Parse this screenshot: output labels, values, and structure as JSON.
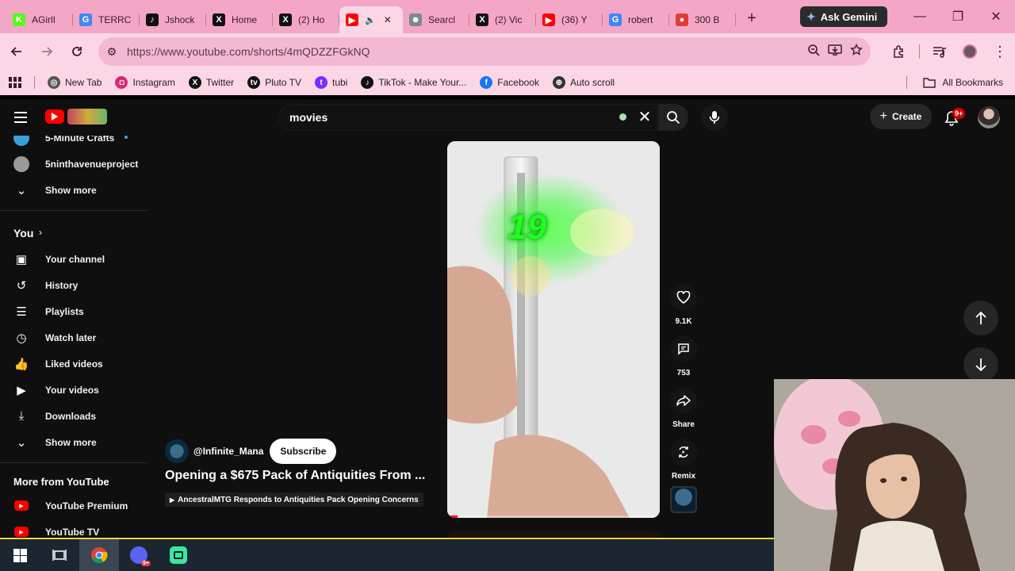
{
  "browser": {
    "tabs": [
      {
        "title": "AGirlI",
        "icon": "kick-icon",
        "color": "#53fc18",
        "glyph": "K"
      },
      {
        "title": "TERRC",
        "icon": "google-icon",
        "color": "#4285f4",
        "glyph": "G"
      },
      {
        "title": "Jshock",
        "icon": "tiktok-icon",
        "color": "#111111",
        "glyph": "♪"
      },
      {
        "title": "Home",
        "icon": "x-icon",
        "color": "#111111",
        "glyph": "X"
      },
      {
        "title": "(2) Ho",
        "icon": "x-icon",
        "color": "#111111",
        "glyph": "X"
      },
      {
        "title": "",
        "icon": "youtube-icon",
        "color": "#ff0000",
        "glyph": "▶",
        "active": true
      },
      {
        "title": "Searcl",
        "icon": "search-site-icon",
        "color": "#7b8a8b",
        "glyph": "☻"
      },
      {
        "title": "(2) Vic",
        "icon": "x-icon",
        "color": "#111111",
        "glyph": "X"
      },
      {
        "title": "(36) Y",
        "icon": "youtube-icon",
        "color": "#ff0000",
        "glyph": "▶"
      },
      {
        "title": "robert",
        "icon": "google-icon",
        "color": "#4285f4",
        "glyph": "G"
      },
      {
        "title": "300 B",
        "icon": "tomato-icon",
        "color": "#e53935",
        "glyph": "●"
      }
    ],
    "new_tab_label": "+",
    "gemini_label": "Ask Gemini",
    "url": "https://www.youtube.com/shorts/4mQDZZFGkNQ",
    "bookmarks": [
      {
        "label": "New Tab",
        "icon": "chrome-icon",
        "color": "#555555",
        "glyph": "◎"
      },
      {
        "label": "Instagram",
        "icon": "instagram-icon",
        "color": "#d62976",
        "glyph": "◘"
      },
      {
        "label": "Twitter",
        "icon": "x-icon",
        "color": "#111111",
        "glyph": "X"
      },
      {
        "label": "Pluto TV",
        "icon": "pluto-tv-icon",
        "color": "#111111",
        "glyph": "tv"
      },
      {
        "label": "tubi",
        "icon": "tubi-icon",
        "color": "#7b2cff",
        "glyph": "t"
      },
      {
        "label": "TikTok - Make Your...",
        "icon": "tiktok-icon",
        "color": "#111111",
        "glyph": "♪"
      },
      {
        "label": "Facebook",
        "icon": "facebook-icon",
        "color": "#1877f2",
        "glyph": "f"
      },
      {
        "label": "Auto scroll",
        "icon": "auto-scroll-icon",
        "color": "#333333",
        "glyph": "⊕"
      }
    ],
    "all_bookmarks_label": "All Bookmarks"
  },
  "youtube": {
    "search_query": "movies",
    "create_label": "Create",
    "notifications_badge": "9+",
    "sidebar": {
      "subscriptions": [
        {
          "label": "5-Minute Crafts",
          "icon": "channel-avatar",
          "color": "#3aa0d8"
        },
        {
          "label": "5ninthavenueproject",
          "icon": "channel-avatar",
          "color": "#9a9a9a"
        }
      ],
      "show_more_label": "Show more",
      "you_label": "You",
      "you_items": [
        {
          "label": "Your channel",
          "icon": "your-channel-icon"
        },
        {
          "label": "History",
          "icon": "history-icon"
        },
        {
          "label": "Playlists",
          "icon": "playlists-icon"
        },
        {
          "label": "Watch later",
          "icon": "watch-later-icon"
        },
        {
          "label": "Liked videos",
          "icon": "liked-videos-icon"
        },
        {
          "label": "Your videos",
          "icon": "your-videos-icon"
        },
        {
          "label": "Downloads",
          "icon": "downloads-icon"
        }
      ],
      "show_more_label_2": "Show more",
      "more_from_label": "More from YouTube",
      "more_items": [
        {
          "label": "YouTube Premium",
          "icon": "youtube-premium-icon"
        },
        {
          "label": "YouTube TV",
          "icon": "youtube-tv-icon"
        }
      ]
    },
    "short": {
      "overlay_text": "19",
      "channel_handle": "@Infinite_Mana",
      "subscribe_label": "Subscribe",
      "title": "Opening a $675 Pack of Antiquities From ...",
      "related_label": "AncestralMTG Responds to Antiquities Pack Opening Concerns",
      "progress": 0.05,
      "likes": "9.1K",
      "comments": "753",
      "share_label": "Share",
      "remix_label": "Remix"
    }
  },
  "taskbar": {
    "apps": [
      {
        "icon": "windows-start-icon"
      },
      {
        "icon": "task-view-icon"
      },
      {
        "icon": "chrome-icon",
        "active": true
      },
      {
        "icon": "discord-icon"
      },
      {
        "icon": "streaming-app-icon"
      }
    ]
  }
}
